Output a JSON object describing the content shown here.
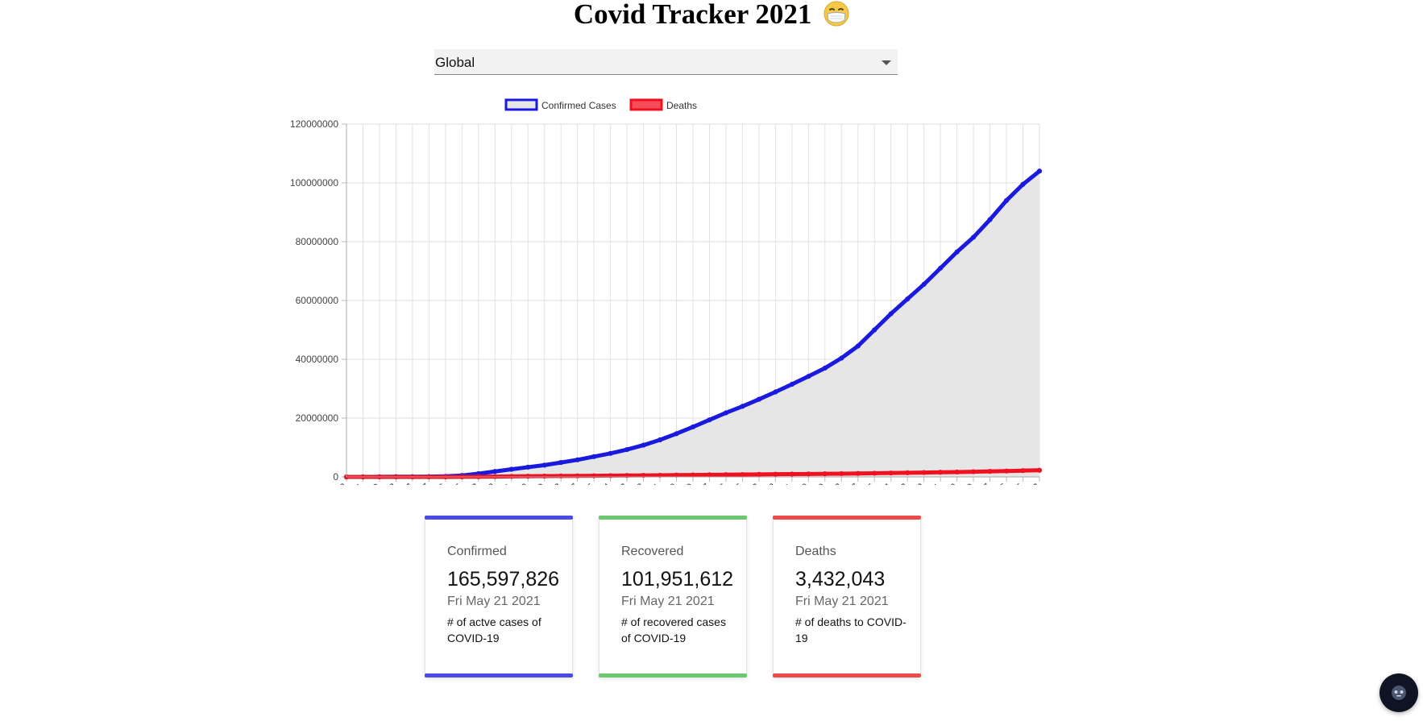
{
  "header": {
    "title": "Covid Tracker 2021",
    "emoji_icon": "face-with-medical-mask-icon"
  },
  "country_select": {
    "selected": "Global",
    "caret_icon": "dropdown-caret-icon"
  },
  "chart_data": {
    "type": "line",
    "title": "",
    "xlabel": "",
    "ylabel": "",
    "ylim": [
      0,
      120000000
    ],
    "y_ticks": [
      "0",
      "20000000",
      "40000000",
      "60000000",
      "80000000",
      "100000000",
      "120000000"
    ],
    "x": [
      "2020-01-22",
      "2020-01-31",
      "2020-02-09",
      "2020-02-18",
      "2020-02-27",
      "2020-03-07",
      "2020-03-16",
      "2020-03-25",
      "2020-04-03",
      "2020-04-12",
      "2020-04-21",
      "2020-04-30",
      "2020-05-09",
      "2020-05-18",
      "2020-05-27",
      "2020-06-05",
      "2020-06-14",
      "2020-06-23",
      "2020-07-02",
      "2020-07-11",
      "2020-07-20",
      "2020-07-29",
      "2020-08-07",
      "2020-08-16",
      "2020-08-25",
      "2020-09-03",
      "2020-09-12",
      "2020-09-21",
      "2020-09-30",
      "2020-10-09",
      "2020-10-18",
      "2020-10-27",
      "2020-11-05",
      "2020-11-14",
      "2020-11-23",
      "2020-12-02",
      "2020-12-11",
      "2020-12-20",
      "2020-12-29",
      "2021-01-07",
      "2021-01-16",
      "2021-01-25",
      "2021-02-03"
    ],
    "legend_position": "top",
    "grid": true,
    "series": [
      {
        "name": "Confirmed Cases",
        "color": "#1a1adf",
        "fill": "#e6e6e6",
        "values": [
          600,
          10000,
          40000,
          75000,
          85000,
          105000,
          190000,
          470000,
          1100000,
          1850000,
          2600000,
          3300000,
          4000000,
          4900000,
          5800000,
          6900000,
          8000000,
          9300000,
          10800000,
          12600000,
          14700000,
          17000000,
          19400000,
          21800000,
          24000000,
          26400000,
          28900000,
          31500000,
          34200000,
          37000000,
          40400000,
          44500000,
          50000000,
          55500000,
          60500000,
          65500000,
          71000000,
          76500000,
          81500000,
          87500000,
          94000000,
          99500000,
          104000000
        ]
      },
      {
        "name": "Deaths",
        "color": "#f01020",
        "fill": "#e6e6e6",
        "values": [
          17,
          210,
          900,
          1900,
          2800,
          3500,
          7500,
          22000,
          60000,
          115000,
          175000,
          230000,
          275000,
          320000,
          355000,
          390000,
          430000,
          470000,
          520000,
          565000,
          615000,
          660000,
          710000,
          760000,
          810000,
          860000,
          910000,
          960000,
          1010000,
          1060000,
          1110000,
          1170000,
          1250000,
          1320000,
          1400000,
          1480000,
          1570000,
          1660000,
          1760000,
          1880000,
          2000000,
          2140000,
          2260000
        ]
      }
    ]
  },
  "cards": [
    {
      "label": "Confirmed",
      "value": "165,597,826",
      "date": "Fri May 21 2021",
      "description": "# of actve cases of COVID-19",
      "color": "#4a4ae6"
    },
    {
      "label": "Recovered",
      "value": "101,951,612",
      "date": "Fri May 21 2021",
      "description": "# of recovered cases of COVID-19",
      "color": "#6cc870"
    },
    {
      "label": "Deaths",
      "value": "3,432,043",
      "date": "Fri May 21 2021",
      "description": "# of deaths to COVID-19",
      "color": "#ef4a4a"
    }
  ],
  "chat_button": {
    "icon": "chat-bot-icon"
  }
}
